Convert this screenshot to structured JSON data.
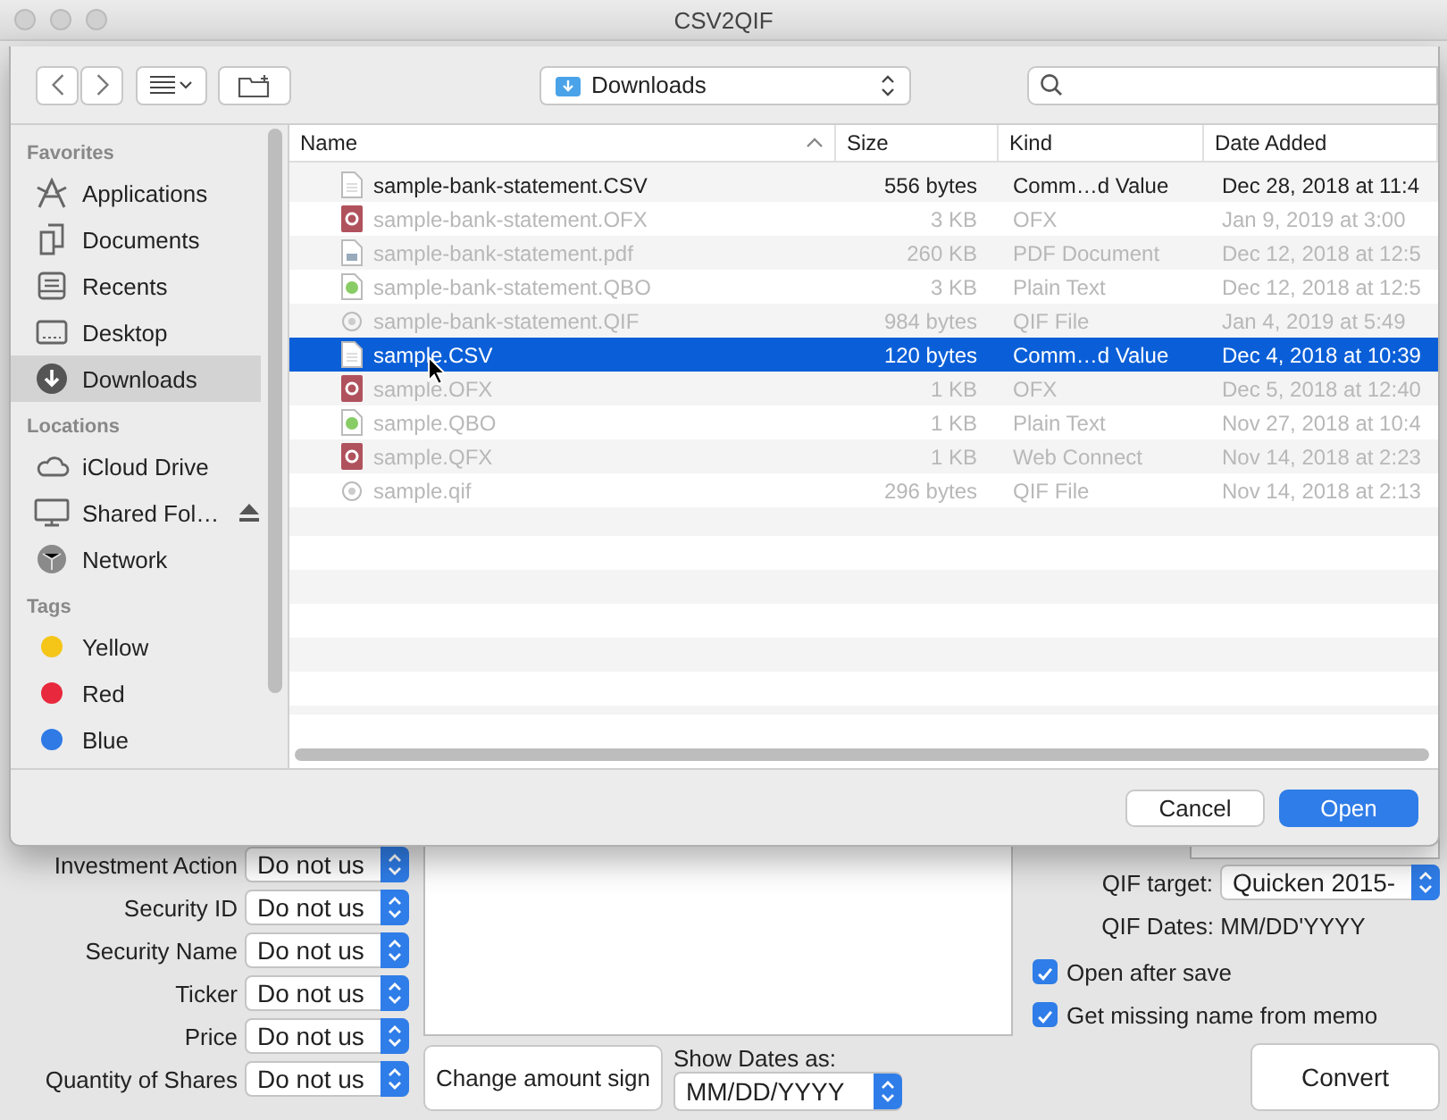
{
  "window": {
    "title": "CSV2QIF"
  },
  "open_dialog": {
    "location": "Downloads",
    "sidebar": [
      {
        "heading": "Favorites",
        "items": [
          {
            "label": "Applications",
            "kind": "applications",
            "selected": false
          },
          {
            "label": "Documents",
            "kind": "documents",
            "selected": false
          },
          {
            "label": "Recents",
            "kind": "recents",
            "selected": false
          },
          {
            "label": "Desktop",
            "kind": "desktop",
            "selected": false
          },
          {
            "label": "Downloads",
            "kind": "downloads",
            "selected": true
          }
        ]
      },
      {
        "heading": "Locations",
        "items": [
          {
            "label": "iCloud Drive",
            "kind": "cloud",
            "selected": false
          },
          {
            "label": "Shared Fol…",
            "kind": "display",
            "selected": false,
            "ejectable": true
          },
          {
            "label": "Network",
            "kind": "network",
            "selected": false
          }
        ]
      },
      {
        "heading": "Tags",
        "items": [
          {
            "label": "Yellow",
            "kind": "tag",
            "color": "#f5c518",
            "selected": false
          },
          {
            "label": "Red",
            "kind": "tag",
            "color": "#e8283c",
            "selected": false
          },
          {
            "label": "Blue",
            "kind": "tag",
            "color": "#2f7ae5",
            "selected": false
          }
        ]
      }
    ],
    "columns": [
      "Name",
      "Size",
      "Kind",
      "Date Added"
    ],
    "rows": [
      {
        "name": "sample-bank-statement.CSV",
        "size": "556 bytes",
        "file_kind": "Comm…d Value",
        "date": "Dec 28, 2018 at 11:4",
        "kind": "doc",
        "enabled": true,
        "selected": false
      },
      {
        "name": "sample-bank-statement.OFX",
        "size": "3 KB",
        "file_kind": "OFX",
        "date": "Jan 9, 2019 at 3:00",
        "kind": "quicken",
        "enabled": false,
        "selected": false
      },
      {
        "name": "sample-bank-statement.pdf",
        "size": "260 KB",
        "file_kind": "PDF Document",
        "date": "Dec 12, 2018 at 12:5",
        "kind": "pdf",
        "enabled": false,
        "selected": false
      },
      {
        "name": "sample-bank-statement.QBO",
        "size": "3 KB",
        "file_kind": "Plain Text",
        "date": "Dec 12, 2018 at 12:5",
        "kind": "qbo",
        "enabled": false,
        "selected": false
      },
      {
        "name": "sample-bank-statement.QIF",
        "size": "984 bytes",
        "file_kind": "QIF File",
        "date": "Jan 4, 2019 at 5:49",
        "kind": "qif",
        "enabled": false,
        "selected": false
      },
      {
        "name": "sample.CSV",
        "size": "120 bytes",
        "file_kind": "Comm…d Value",
        "date": "Dec 4, 2018 at 10:39",
        "kind": "doc",
        "enabled": true,
        "selected": true
      },
      {
        "name": "sample.OFX",
        "size": "1 KB",
        "file_kind": "OFX",
        "date": "Dec 5, 2018 at 12:40",
        "kind": "quicken",
        "enabled": false,
        "selected": false
      },
      {
        "name": "sample.QBO",
        "size": "1 KB",
        "file_kind": "Plain Text",
        "date": "Nov 27, 2018 at 10:4",
        "kind": "qbo",
        "enabled": false,
        "selected": false
      },
      {
        "name": "sample.QFX",
        "size": "1 KB",
        "file_kind": "Web Connect",
        "date": "Nov 14, 2018 at 2:23",
        "kind": "quicken",
        "enabled": false,
        "selected": false
      },
      {
        "name": "sample.qif",
        "size": "296 bytes",
        "file_kind": "QIF File",
        "date": "Nov 14, 2018 at 2:13",
        "kind": "qif",
        "enabled": false,
        "selected": false
      }
    ],
    "buttons": [
      {
        "label": "Cancel",
        "default": false
      },
      {
        "label": "Open",
        "default": true
      }
    ]
  },
  "form": {
    "mappings": [
      {
        "label": "Investment Action",
        "value": "Do not us"
      },
      {
        "label": "Security ID",
        "value": "Do not us"
      },
      {
        "label": "Security Name",
        "value": "Do not us"
      },
      {
        "label": "Ticker",
        "value": "Do not us"
      },
      {
        "label": "Price",
        "value": "Do not us"
      },
      {
        "label": "Quantity of Shares",
        "value": "Do not us"
      }
    ],
    "change_sign_button": "Change amount sign",
    "show_dates": {
      "label": "Show Dates as:",
      "value": "MM/DD/YYYY"
    },
    "qif_target": {
      "label": "QIF target:",
      "value": "Quicken 2015-"
    },
    "qif_dates": "QIF Dates: MM/DD'YYYY",
    "options": [
      {
        "label": "Open after save",
        "checked": true
      },
      {
        "label": "Get missing name from memo",
        "checked": true
      }
    ],
    "convert_button": "Convert"
  }
}
